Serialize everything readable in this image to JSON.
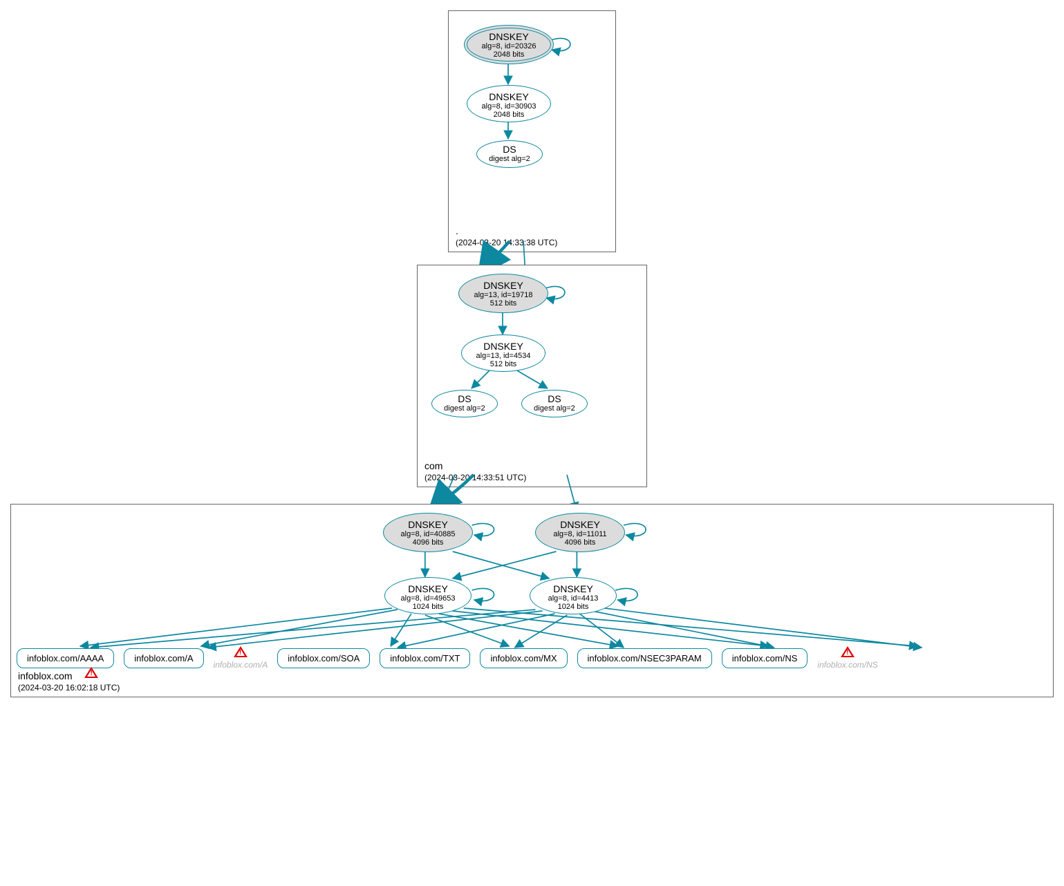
{
  "zones": {
    "root": {
      "name": ".",
      "timestamp": "(2024-03-20 14:33:38 UTC)",
      "ksk": {
        "title": "DNSKEY",
        "alg": "alg=8, id=20326",
        "bits": "2048 bits"
      },
      "zsk": {
        "title": "DNSKEY",
        "alg": "alg=8, id=30903",
        "bits": "2048 bits"
      },
      "ds": {
        "title": "DS",
        "digest": "digest alg=2"
      }
    },
    "com": {
      "name": "com",
      "timestamp": "(2024-03-20 14:33:51 UTC)",
      "ksk": {
        "title": "DNSKEY",
        "alg": "alg=13, id=19718",
        "bits": "512 bits"
      },
      "zsk": {
        "title": "DNSKEY",
        "alg": "alg=13, id=4534",
        "bits": "512 bits"
      },
      "ds1": {
        "title": "DS",
        "digest": "digest alg=2"
      },
      "ds2": {
        "title": "DS",
        "digest": "digest alg=2"
      }
    },
    "inf": {
      "name": "infoblox.com",
      "timestamp": "(2024-03-20 16:02:18 UTC)",
      "ksk1": {
        "title": "DNSKEY",
        "alg": "alg=8, id=40885",
        "bits": "4096 bits"
      },
      "ksk2": {
        "title": "DNSKEY",
        "alg": "alg=8, id=11011",
        "bits": "4096 bits"
      },
      "zsk1": {
        "title": "DNSKEY",
        "alg": "alg=8, id=49653",
        "bits": "1024 bits"
      },
      "zsk2": {
        "title": "DNSKEY",
        "alg": "alg=8, id=4413",
        "bits": "1024 bits"
      },
      "rr": [
        "infoblox.com/AAAA",
        "infoblox.com/A",
        "infoblox.com/SOA",
        "infoblox.com/TXT",
        "infoblox.com/MX",
        "infoblox.com/NSEC3PARAM",
        "infoblox.com/NS"
      ],
      "ghost": [
        "infoblox.com/A",
        "infoblox.com/NS"
      ]
    }
  }
}
